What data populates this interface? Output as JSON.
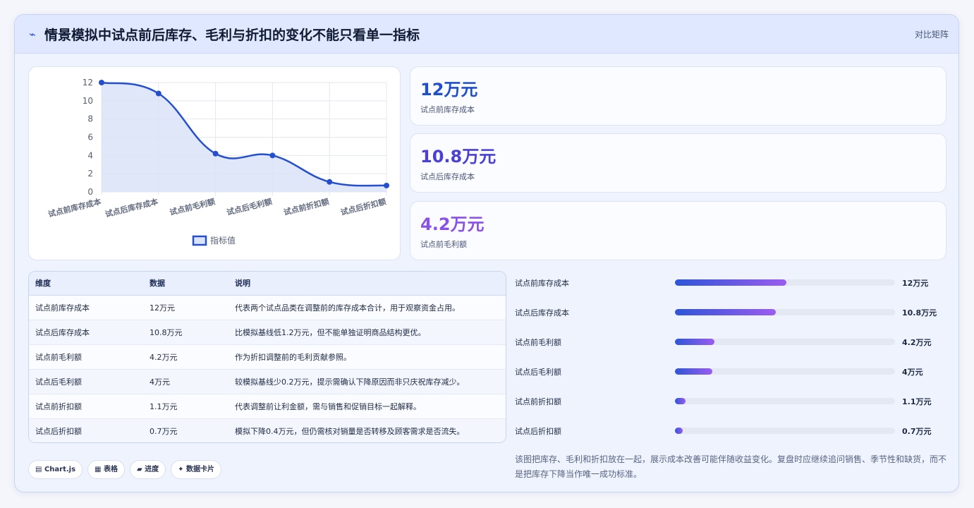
{
  "header": {
    "icon": "spark-icon",
    "title": "情景模拟中试点前后库存、毛利与折扣的变化不能只看单一指标",
    "right_label": "对比矩阵"
  },
  "stats": [
    {
      "value": "12万元",
      "label": "试点前库存成本",
      "color": "#1f4fd1"
    },
    {
      "value": "10.8万元",
      "label": "试点后库存成本",
      "color": "#4a3fd6"
    },
    {
      "value": "4.2万元",
      "label": "试点前毛利额",
      "color": "#8a50ea"
    }
  ],
  "table": {
    "headers": [
      "维度",
      "数据",
      "说明"
    ],
    "rows": [
      [
        "试点前库存成本",
        "12万元",
        "代表两个试点品类在调整前的库存成本合计，用于观察资金占用。"
      ],
      [
        "试点后库存成本",
        "10.8万元",
        "比模拟基线低1.2万元，但不能单独证明商品结构更优。"
      ],
      [
        "试点前毛利额",
        "4.2万元",
        "作为折扣调整前的毛利贡献参照。"
      ],
      [
        "试点后毛利额",
        "4万元",
        "较模拟基线少0.2万元，提示需确认下降原因而非只庆祝库存减少。"
      ],
      [
        "试点前折扣额",
        "1.1万元",
        "代表调整前让利金额，需与销售和促销目标一起解释。"
      ],
      [
        "试点后折扣额",
        "0.7万元",
        "模拟下降0.4万元，但仍需核对销量是否转移及顾客需求是否流失。"
      ]
    ]
  },
  "progress": [
    {
      "label": "试点前库存成本",
      "value": "12万元",
      "fraction": 0.508
    },
    {
      "label": "试点后库存成本",
      "value": "10.8万元",
      "fraction": 0.457
    },
    {
      "label": "试点前毛利额",
      "value": "4.2万元",
      "fraction": 0.178
    },
    {
      "label": "试点后毛利额",
      "value": "4万元",
      "fraction": 0.169
    },
    {
      "label": "试点前折扣额",
      "value": "1.1万元",
      "fraction": 0.047
    },
    {
      "label": "试点后折扣额",
      "value": "0.7万元",
      "fraction": 0.03
    }
  ],
  "tags": [
    {
      "icon": "chart-icon",
      "glyph": "▤",
      "label": "Chart.js"
    },
    {
      "icon": "table-icon",
      "glyph": "▦",
      "label": "表格"
    },
    {
      "icon": "progress-icon",
      "glyph": "▰",
      "label": "进度"
    },
    {
      "icon": "sparkle-icon",
      "glyph": "✦",
      "label": "数据卡片"
    }
  ],
  "note": "该图把库存、毛利和折扣放在一起，展示成本改善可能伴随收益变化。复盘时应继续追问销售、季节性和缺货，而不是把库存下降当作唯一成功标准。",
  "chart_data": {
    "type": "line",
    "categories": [
      "试点前库存成本",
      "试点后库存成本",
      "试点前毛利额",
      "试点后毛利额",
      "试点前折扣额",
      "试点后折扣额"
    ],
    "series": [
      {
        "name": "指标值",
        "values": [
          12,
          10.8,
          4.2,
          4,
          1.1,
          0.7
        ]
      }
    ],
    "ylim": [
      0,
      12
    ],
    "yticks": [
      0,
      2,
      4,
      6,
      8,
      10,
      12
    ],
    "grid": true,
    "legend": "bottom",
    "line_color": "#2450cf",
    "fill_color": "#dbe3f7"
  }
}
